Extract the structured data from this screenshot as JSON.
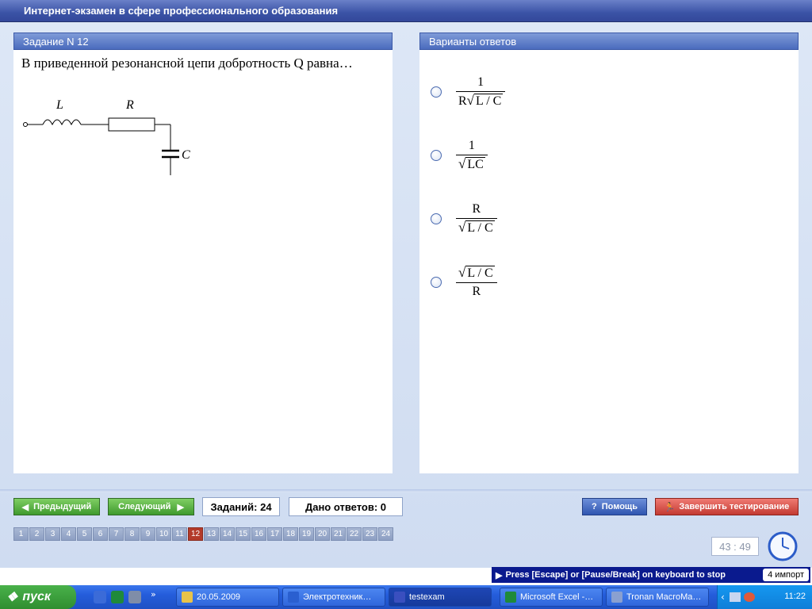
{
  "window": {
    "title": "Интернет-экзамен в сфере профессионального образования"
  },
  "task": {
    "header": "Задание N 12",
    "question": "В приведенной резонансной цепи добротность Q равна…",
    "circuit": {
      "inductor_label": "L",
      "resistor_label": "R",
      "capacitor_label": "C"
    }
  },
  "answers": {
    "header": "Варианты ответов",
    "options": [
      {
        "num": "1",
        "den_pre": "R",
        "den_rad": "L / C"
      },
      {
        "num": "1",
        "den_pre": "",
        "den_rad": "LC"
      },
      {
        "num": "R",
        "den_pre": "",
        "den_rad": "L / C"
      },
      {
        "num_rad": "L / C",
        "den": "R"
      }
    ]
  },
  "nav": {
    "prev_label": "Предыдущий",
    "next_label": "Следующий",
    "tasks_count": "Заданий: 24",
    "answers_given": "Дано ответов: 0",
    "help_label": "Помощь",
    "finish_label": "Завершить тестирование",
    "current_page": 12,
    "pages": [
      "1",
      "2",
      "3",
      "4",
      "5",
      "6",
      "7",
      "8",
      "9",
      "10",
      "11",
      "12",
      "13",
      "14",
      "15",
      "16",
      "17",
      "18",
      "19",
      "20",
      "21",
      "22",
      "23",
      "24"
    ]
  },
  "timer": "43 : 49",
  "escape_bar": {
    "text": "Press [Escape] or [Pause/Break] on keyboard to stop",
    "lang": "4 импорт"
  },
  "taskbar": {
    "start_label": "пуск",
    "tasks": [
      {
        "label": "20.05.2009",
        "color": "#e8c34a"
      },
      {
        "label": "Электротехник…",
        "color": "#2a5fd0"
      },
      {
        "label": "testexam",
        "color": "#3a4fbf"
      },
      {
        "label": "Microsoft Excel -…",
        "color": "#1f8a3a"
      },
      {
        "label": "Tronan MacroMa…",
        "color": "#8aa0d0"
      }
    ],
    "clock": "11:22"
  },
  "colors": {
    "header_blue": "#4a6bbd",
    "active_page": "#b33a2a",
    "taskbar": "#245ddb"
  }
}
